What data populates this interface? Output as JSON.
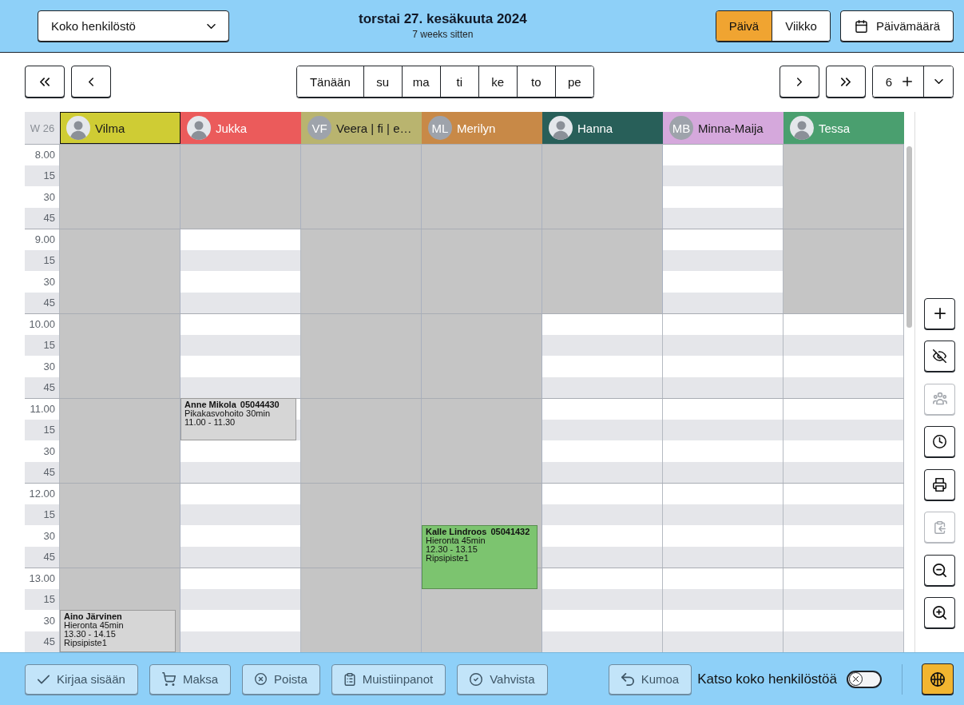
{
  "header": {
    "staff_select": {
      "value": "Koko henkilöstö"
    },
    "date": "torstai 27. kesäkuuta 2024",
    "relative": "7 weeks sitten",
    "views": [
      {
        "label": "Päivä",
        "selected": true
      },
      {
        "label": "Viikko",
        "selected": false
      }
    ],
    "date_button": "Päivämäärä"
  },
  "navigation": {
    "quick_days": [
      "Tänään",
      "su",
      "ma",
      "ti",
      "ke",
      "to",
      "pe"
    ],
    "count": "6"
  },
  "calendar": {
    "week": "W 26",
    "times": [
      "8.00",
      "15",
      "30",
      "45",
      "9.00",
      "15",
      "30",
      "45",
      "10.00",
      "15",
      "30",
      "45",
      "11.00",
      "15",
      "30",
      "45",
      "12.00",
      "15",
      "30",
      "45",
      "13.00",
      "15",
      "30",
      "45"
    ],
    "staff": [
      {
        "name": "Vilma",
        "color": "#cfcc34",
        "selected": true,
        "slots": [
          {
            "off": true,
            "busy": false
          },
          {
            "off": true,
            "busy": false
          },
          {
            "off": true,
            "busy": false
          },
          {
            "off": true,
            "busy": false
          },
          {
            "off": true,
            "busy": false
          },
          {
            "off": true,
            "busy": false
          },
          {
            "off": true,
            "busy": false
          },
          {
            "off": true,
            "busy": false
          },
          {
            "off": true,
            "busy": false
          },
          {
            "off": true,
            "busy": false
          },
          {
            "off": true,
            "busy": false
          },
          {
            "off": true,
            "busy": false
          },
          {
            "off": true,
            "busy": false
          },
          {
            "off": true,
            "busy": false
          },
          {
            "off": true,
            "busy": false
          },
          {
            "off": true,
            "busy": false
          },
          {
            "off": true,
            "busy": false
          },
          {
            "off": true,
            "busy": false
          },
          {
            "off": true,
            "busy": false
          },
          {
            "off": true,
            "busy": false
          },
          {
            "off": true,
            "busy": false
          },
          {
            "off": true,
            "busy": false
          },
          {
            "off": true,
            "busy": true,
            "event": {
              "client": "Aino Järvinen",
              "service": "Hieronta 45min",
              "time": "13.30 - 14.15",
              "place": "Ripsipiste1",
              "color": "#d6d6d6"
            }
          },
          {
            "off": true,
            "busy": true
          }
        ]
      },
      {
        "name": "Jukka",
        "color": "#eb5b5b",
        "selected": false,
        "slots": [
          {
            "off": true,
            "busy": false
          },
          {
            "off": true,
            "busy": false
          },
          {
            "off": true,
            "busy": false
          },
          {
            "off": true,
            "busy": false
          },
          {
            "off": false,
            "busy": false
          },
          {
            "off": false,
            "busy": false
          },
          {
            "off": false,
            "busy": false
          },
          {
            "off": false,
            "busy": false
          },
          {
            "off": false,
            "busy": false
          },
          {
            "off": false,
            "busy": false
          },
          {
            "off": false,
            "busy": false
          },
          {
            "off": false,
            "busy": false
          },
          {
            "off": false,
            "busy": true,
            "event": {
              "client": "Anne Mikola",
              "phone": "05044430",
              "service": "Pikakasvohoito 30min",
              "time": "11.00 - 11.30",
              "color": "#d6d6d6"
            }
          },
          {
            "off": false,
            "busy": true
          },
          {
            "off": false,
            "busy": false
          },
          {
            "off": false,
            "busy": false
          },
          {
            "off": false,
            "busy": false
          },
          {
            "off": false,
            "busy": false
          },
          {
            "off": false,
            "busy": false
          },
          {
            "off": false,
            "busy": false
          },
          {
            "off": false,
            "busy": false
          },
          {
            "off": false,
            "busy": false
          },
          {
            "off": false,
            "busy": false
          },
          {
            "off": false,
            "busy": false
          }
        ]
      },
      {
        "name": "Veera | fi | e…",
        "initials": "VF",
        "color": "#b9b46f",
        "selected": false,
        "slots": [
          {
            "off": true,
            "busy": false
          },
          {
            "off": true,
            "busy": false
          },
          {
            "off": true,
            "busy": false
          },
          {
            "off": true,
            "busy": false
          },
          {
            "off": true,
            "busy": false
          },
          {
            "off": true,
            "busy": false
          },
          {
            "off": true,
            "busy": false
          },
          {
            "off": true,
            "busy": false
          },
          {
            "off": true,
            "busy": false
          },
          {
            "off": true,
            "busy": false
          },
          {
            "off": true,
            "busy": false
          },
          {
            "off": true,
            "busy": false
          },
          {
            "off": true,
            "busy": false
          },
          {
            "off": true,
            "busy": false
          },
          {
            "off": true,
            "busy": false
          },
          {
            "off": true,
            "busy": false
          },
          {
            "off": true,
            "busy": false
          },
          {
            "off": true,
            "busy": false
          },
          {
            "off": true,
            "busy": false
          },
          {
            "off": true,
            "busy": false
          },
          {
            "off": true,
            "busy": false
          },
          {
            "off": true,
            "busy": false
          },
          {
            "off": true,
            "busy": false
          },
          {
            "off": true,
            "busy": false
          }
        ]
      },
      {
        "name": "Merilyn",
        "initials": "ML",
        "color": "#c88947",
        "selected": false,
        "slots": [
          {
            "off": true,
            "busy": false
          },
          {
            "off": true,
            "busy": false
          },
          {
            "off": true,
            "busy": false
          },
          {
            "off": true,
            "busy": false
          },
          {
            "off": true,
            "busy": false
          },
          {
            "off": true,
            "busy": false
          },
          {
            "off": true,
            "busy": false
          },
          {
            "off": true,
            "busy": false
          },
          {
            "off": true,
            "busy": false
          },
          {
            "off": true,
            "busy": false
          },
          {
            "off": true,
            "busy": false
          },
          {
            "off": true,
            "busy": false
          },
          {
            "off": true,
            "busy": false
          },
          {
            "off": true,
            "busy": false
          },
          {
            "off": true,
            "busy": false
          },
          {
            "off": true,
            "busy": false
          },
          {
            "off": true,
            "busy": false
          },
          {
            "off": true,
            "busy": false
          },
          {
            "off": true,
            "busy": true,
            "event": {
              "client": "Kalle Lindroos",
              "phone": "05041432",
              "service": "Hieronta 45min",
              "time": "12.30 - 13.15",
              "place": "Ripsipiste1",
              "color": "#7cc46f"
            }
          },
          {
            "off": true,
            "busy": true
          },
          {
            "off": true,
            "busy": true
          },
          {
            "off": true,
            "busy": false
          },
          {
            "off": true,
            "busy": false
          },
          {
            "off": true,
            "busy": false
          }
        ]
      },
      {
        "name": "Hanna",
        "color": "#285f59",
        "selected": false,
        "slots": [
          {
            "off": true,
            "busy": false
          },
          {
            "off": true,
            "busy": false
          },
          {
            "off": true,
            "busy": false
          },
          {
            "off": true,
            "busy": false
          },
          {
            "off": true,
            "busy": false
          },
          {
            "off": true,
            "busy": false
          },
          {
            "off": true,
            "busy": false
          },
          {
            "off": true,
            "busy": false
          },
          {
            "off": false,
            "busy": false
          },
          {
            "off": false,
            "busy": false
          },
          {
            "off": false,
            "busy": false
          },
          {
            "off": false,
            "busy": false
          },
          {
            "off": false,
            "busy": false
          },
          {
            "off": false,
            "busy": false
          },
          {
            "off": false,
            "busy": false
          },
          {
            "off": false,
            "busy": false
          },
          {
            "off": false,
            "busy": false
          },
          {
            "off": false,
            "busy": false
          },
          {
            "off": false,
            "busy": false
          },
          {
            "off": false,
            "busy": false
          },
          {
            "off": false,
            "busy": false
          },
          {
            "off": false,
            "busy": false
          },
          {
            "off": false,
            "busy": false
          },
          {
            "off": false,
            "busy": false
          }
        ]
      },
      {
        "name": "Minna-Maija",
        "initials": "MB",
        "color": "#d5a8dc",
        "selected": false,
        "slots": [
          {
            "off": false,
            "busy": false
          },
          {
            "off": false,
            "busy": false
          },
          {
            "off": false,
            "busy": false
          },
          {
            "off": false,
            "busy": false
          },
          {
            "off": false,
            "busy": false
          },
          {
            "off": false,
            "busy": false
          },
          {
            "off": false,
            "busy": false
          },
          {
            "off": false,
            "busy": false
          },
          {
            "off": false,
            "busy": false
          },
          {
            "off": false,
            "busy": false
          },
          {
            "off": false,
            "busy": false
          },
          {
            "off": false,
            "busy": false
          },
          {
            "off": false,
            "busy": false
          },
          {
            "off": false,
            "busy": false
          },
          {
            "off": false,
            "busy": false
          },
          {
            "off": false,
            "busy": false
          },
          {
            "off": false,
            "busy": false
          },
          {
            "off": false,
            "busy": false
          },
          {
            "off": false,
            "busy": false
          },
          {
            "off": false,
            "busy": false
          },
          {
            "off": false,
            "busy": false
          },
          {
            "off": false,
            "busy": false
          },
          {
            "off": false,
            "busy": false
          },
          {
            "off": false,
            "busy": false
          }
        ]
      },
      {
        "name": "Tessa",
        "color": "#4a9f6f",
        "selected": false,
        "slots": [
          {
            "off": true,
            "busy": false
          },
          {
            "off": true,
            "busy": false
          },
          {
            "off": true,
            "busy": false
          },
          {
            "off": true,
            "busy": false
          },
          {
            "off": true,
            "busy": false
          },
          {
            "off": true,
            "busy": false
          },
          {
            "off": true,
            "busy": false
          },
          {
            "off": true,
            "busy": false
          },
          {
            "off": false,
            "busy": false
          },
          {
            "off": false,
            "busy": false
          },
          {
            "off": false,
            "busy": false
          },
          {
            "off": false,
            "busy": false
          },
          {
            "off": false,
            "busy": false
          },
          {
            "off": false,
            "busy": false
          },
          {
            "off": false,
            "busy": false
          },
          {
            "off": false,
            "busy": false
          },
          {
            "off": false,
            "busy": false
          },
          {
            "off": false,
            "busy": false
          },
          {
            "off": false,
            "busy": false
          },
          {
            "off": false,
            "busy": false
          },
          {
            "off": false,
            "busy": false
          },
          {
            "off": false,
            "busy": false
          },
          {
            "off": false,
            "busy": false
          },
          {
            "off": false,
            "busy": false
          }
        ]
      }
    ]
  },
  "side_tools": [
    {
      "kind": "add",
      "disabled": false
    },
    {
      "kind": "hide",
      "disabled": false
    },
    {
      "kind": "staff",
      "disabled": true
    },
    {
      "kind": "clock",
      "disabled": false
    },
    {
      "kind": "print",
      "disabled": false
    },
    {
      "kind": "paste",
      "disabled": true
    },
    {
      "kind": "zoomout",
      "disabled": false
    },
    {
      "kind": "zoomin",
      "disabled": false
    }
  ],
  "footer": {
    "actions": [
      {
        "kind": "checkin",
        "label": "Kirjaa sisään",
        "disabled": true
      },
      {
        "kind": "pay",
        "label": "Maksa",
        "disabled": true
      },
      {
        "kind": "delete",
        "label": "Poista",
        "disabled": true
      },
      {
        "kind": "notes",
        "label": "Muistiinpanot",
        "disabled": true
      },
      {
        "kind": "confirm",
        "label": "Vahvista",
        "disabled": true
      }
    ],
    "undo": {
      "label": "Kumoa",
      "disabled": true
    },
    "show_all": {
      "label": "Katso koko henkilöstöä",
      "on": false
    }
  }
}
